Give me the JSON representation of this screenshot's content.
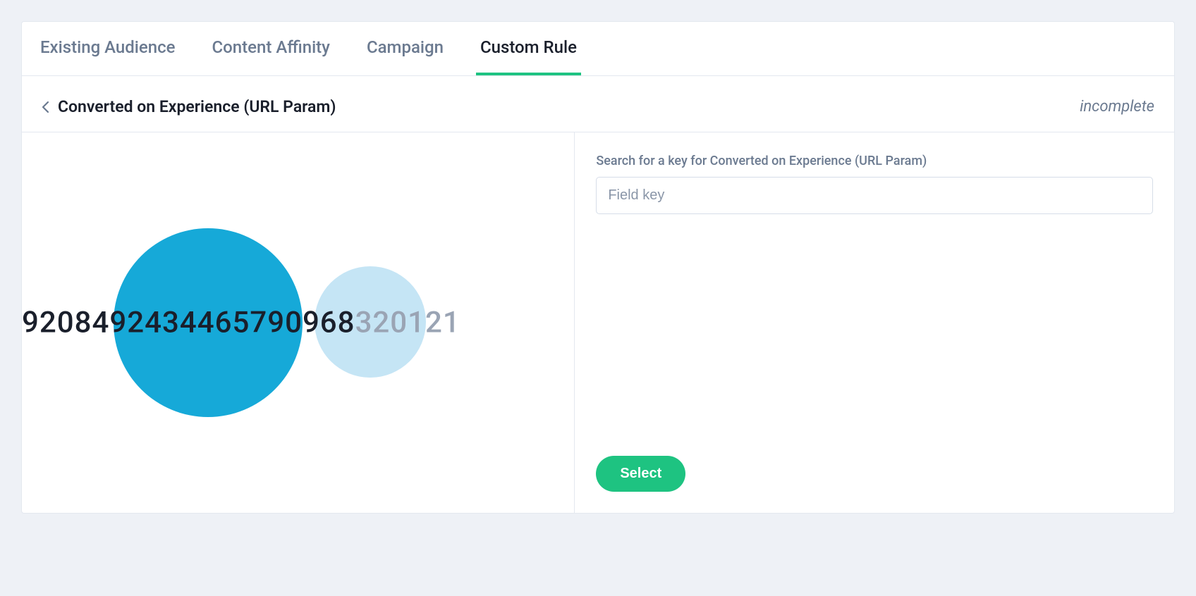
{
  "tabs": {
    "existing_audience": "Existing Audience",
    "content_affinity": "Content Affinity",
    "campaign": "Campaign",
    "custom_rule": "Custom Rule"
  },
  "subheader": {
    "title": "Converted on Experience (URL Param)",
    "status": "incomplete"
  },
  "bubbles": {
    "number_dark": "9208492434465790968",
    "number_faded": "320121"
  },
  "search": {
    "label": "Search for a key for Converted on Experience (URL Param)",
    "placeholder": "Field key"
  },
  "buttons": {
    "select": "Select"
  }
}
